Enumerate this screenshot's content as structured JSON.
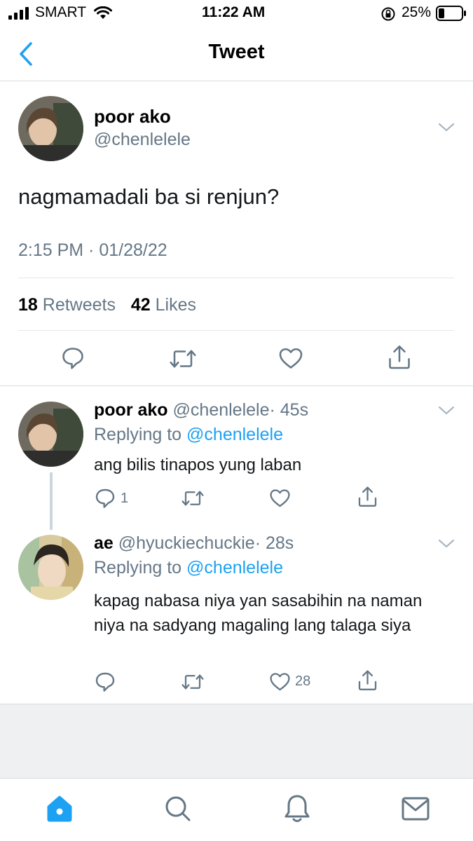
{
  "status_bar": {
    "carrier": "SMART",
    "time": "11:22 AM",
    "battery": "25%"
  },
  "nav": {
    "back_icon": "chevron-left-icon",
    "title": "Tweet"
  },
  "main_tweet": {
    "name": "poor ako",
    "handle": "@chenlelele",
    "text": "nagmamadali ba si renjun?",
    "timestamp": "2:15 PM · 01/28/22",
    "retweets_count": "18",
    "retweets_label": "Retweets",
    "likes_count": "42",
    "likes_label": "Likes"
  },
  "replies": [
    {
      "name": "poor ako",
      "handle": "@chenlelele",
      "time": "· 45s",
      "replying_prefix": "Replying to",
      "replying_to": "@chenlelele",
      "text": "ang bilis tinapos yung laban",
      "reply_count": "1",
      "retweet_count": "",
      "like_count": ""
    },
    {
      "name": "ae",
      "handle": "@hyuckiechuckie",
      "time": "· 28s",
      "replying_prefix": "Replying to",
      "replying_to": "@chenlelele",
      "text": "kapag nabasa niya yan sasabihin na naman niya na sadyang magaling lang talaga siya",
      "reply_count": "",
      "retweet_count": "",
      "like_count": "28"
    }
  ],
  "tab_bar": {
    "items": [
      "home-icon",
      "search-icon",
      "notifications-bell-icon",
      "messages-envelope-icon"
    ]
  },
  "colors": {
    "accent": "#1da1f2",
    "secondary_text": "#657786",
    "divider": "#e1e8ed",
    "footer_bg": "#eef0f2"
  }
}
